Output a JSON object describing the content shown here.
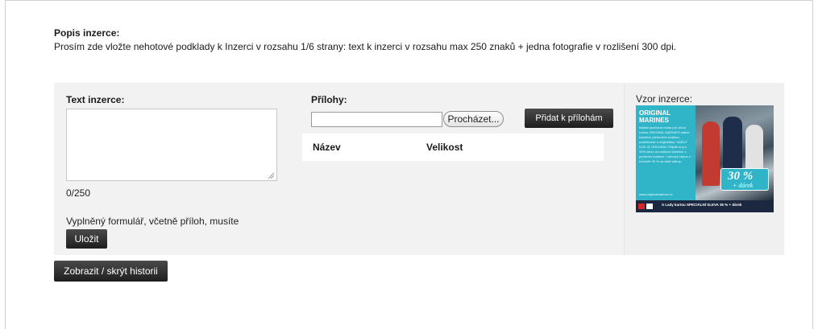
{
  "intro": {
    "title": "Popis inzerce:",
    "text": "Prosím zde vložte nehotové podklady k Inzerci v rozsahu 1/6 strany: text k inzerci v rozsahu max 250 znaků + jedna fotografie v rozlišení 300 dpi."
  },
  "form": {
    "text_label": "Text inzerce:",
    "text_value": "",
    "counter": "0/250",
    "attachments_label": "Přílohy:",
    "file_input_value": "",
    "browse_label": "Procházet...",
    "add_label": "Přidat k přílohám",
    "table_headers": [
      "Název",
      "Velikost"
    ],
    "footer_note": "Vyplněný formulář, včetně příloh, musíte",
    "save_label": "Uložit"
  },
  "sample": {
    "label": "Vzor inzerce:",
    "ad": {
      "title_line1": "ORIGINAL",
      "title_line2": "MARINES",
      "body": "Italská sportovní móda pro celou rodinu ORIGINAL MARINES nabízí každého především kvalitou, praktičností a originalitou. KAŽDÝ KUS JE ORIGINÁL! Přijďte si pro 30% slevu na veškeré oblečení z podzimní kolekce + slevový kupon v hodnotě 30 % na další nákup.",
      "url": "www.originalmarines.cz",
      "percent": "30 %",
      "gift": "+ dárek",
      "strip_text": "S Lady kartou SPECIÁLNÍ SLEVA 35 % + dárek",
      "brand_color": "#2fb4c8"
    }
  },
  "history_label": "Zobrazit / skrýt historii"
}
